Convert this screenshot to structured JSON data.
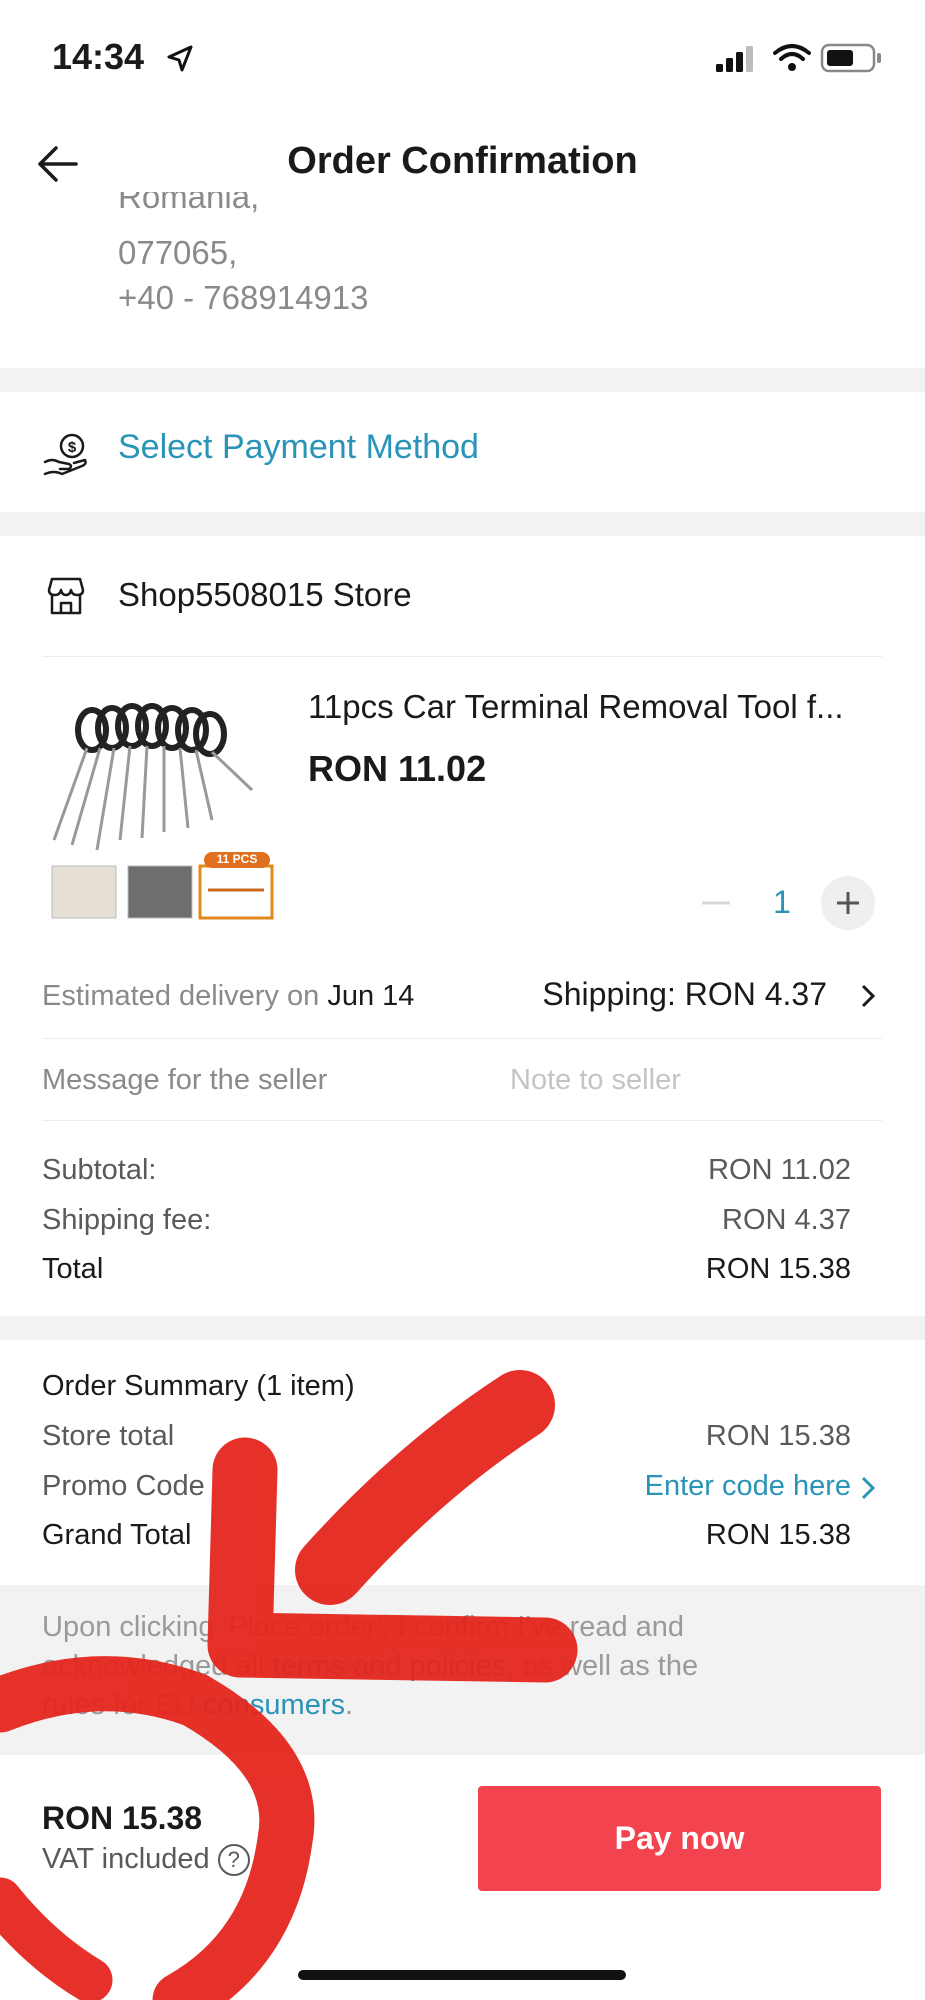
{
  "status_bar": {
    "time": "14:34"
  },
  "header": {
    "title": "Order Confirmation"
  },
  "address": {
    "line_partial": "Romania,",
    "postcode": "077065,",
    "phone": "+40 - 768914913"
  },
  "payment": {
    "label": "Select Payment Method"
  },
  "store": {
    "name": "Shop5508015 Store"
  },
  "product": {
    "title": "11pcs Car Terminal Removal Tool f...",
    "price": "RON 11.02",
    "badge": "11 PCS",
    "quantity": "1"
  },
  "delivery": {
    "estimated_label": "Estimated delivery on",
    "estimated_date": "Jun 14",
    "shipping": "Shipping: RON 4.37"
  },
  "message": {
    "label": "Message for the seller",
    "placeholder": "Note to seller"
  },
  "costs": {
    "subtotal_label": "Subtotal:",
    "subtotal_value": "RON 11.02",
    "shipping_label": "Shipping fee:",
    "shipping_value": "RON 4.37",
    "total_label": "Total",
    "total_value": "RON 15.38"
  },
  "summary": {
    "title": "Order Summary (1 item)",
    "store_total_label": "Store total",
    "store_total_value": "RON 15.38",
    "promo_label": "Promo Code",
    "promo_link": "Enter code here",
    "grand_total_label": "Grand Total",
    "grand_total_value": "RON 15.38"
  },
  "terms": {
    "line1": "Upon clicking 'Place order', I confirm I've read and",
    "line2_pre": "acknowledged all ",
    "line2_link": "terms and policies",
    "line2_post": ", as well as the",
    "line3_pre": "rules for EU ",
    "line3_link": "consumers",
    "line3_post": "."
  },
  "footer": {
    "price": "RON 15.38",
    "vat": "VAT included",
    "help": "?",
    "pay_button": "Pay now"
  },
  "colors": {
    "accent": "#2a93b8",
    "pay_button": "#f2434f",
    "annotation": "#e4261d"
  }
}
